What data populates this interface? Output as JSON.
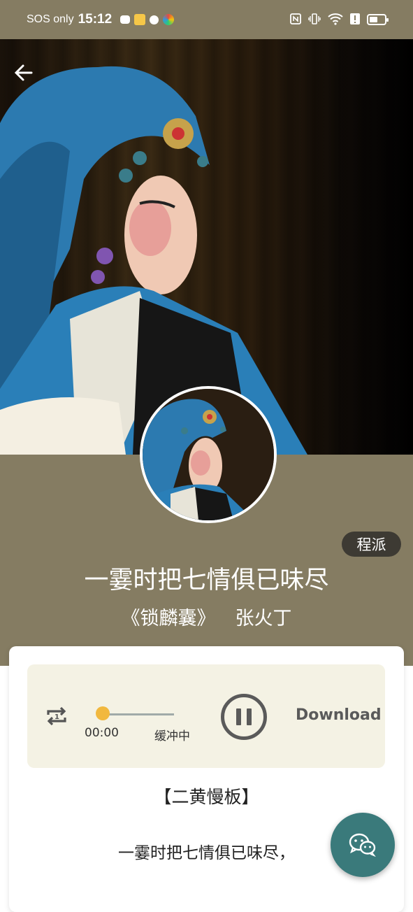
{
  "status_bar": {
    "carrier": "SOS only",
    "time": "15:12",
    "battery_level": 0.55
  },
  "header": {
    "back_icon": "arrow-left-icon"
  },
  "song": {
    "genre": "程派",
    "title": "一霎时把七情俱已味尽",
    "opera": "《锁麟囊》",
    "role": "张火丁"
  },
  "player": {
    "repeat_icon": "repeat-one-icon",
    "current_time": "00:00",
    "status": "缓冲中",
    "progress": 0.0,
    "pause_icon": "pause-icon",
    "download_label": "Download"
  },
  "lyrics": {
    "section": "【二黄慢板】",
    "lines": [
      "一霎时把七情俱已味尽，"
    ]
  },
  "fab": {
    "icon": "wechat-icon"
  },
  "colors": {
    "header_bg": "#857c62",
    "player_bg": "#f4f2e4",
    "progress_knob": "#f1b83e",
    "fab_bg": "#3a7a7b"
  }
}
